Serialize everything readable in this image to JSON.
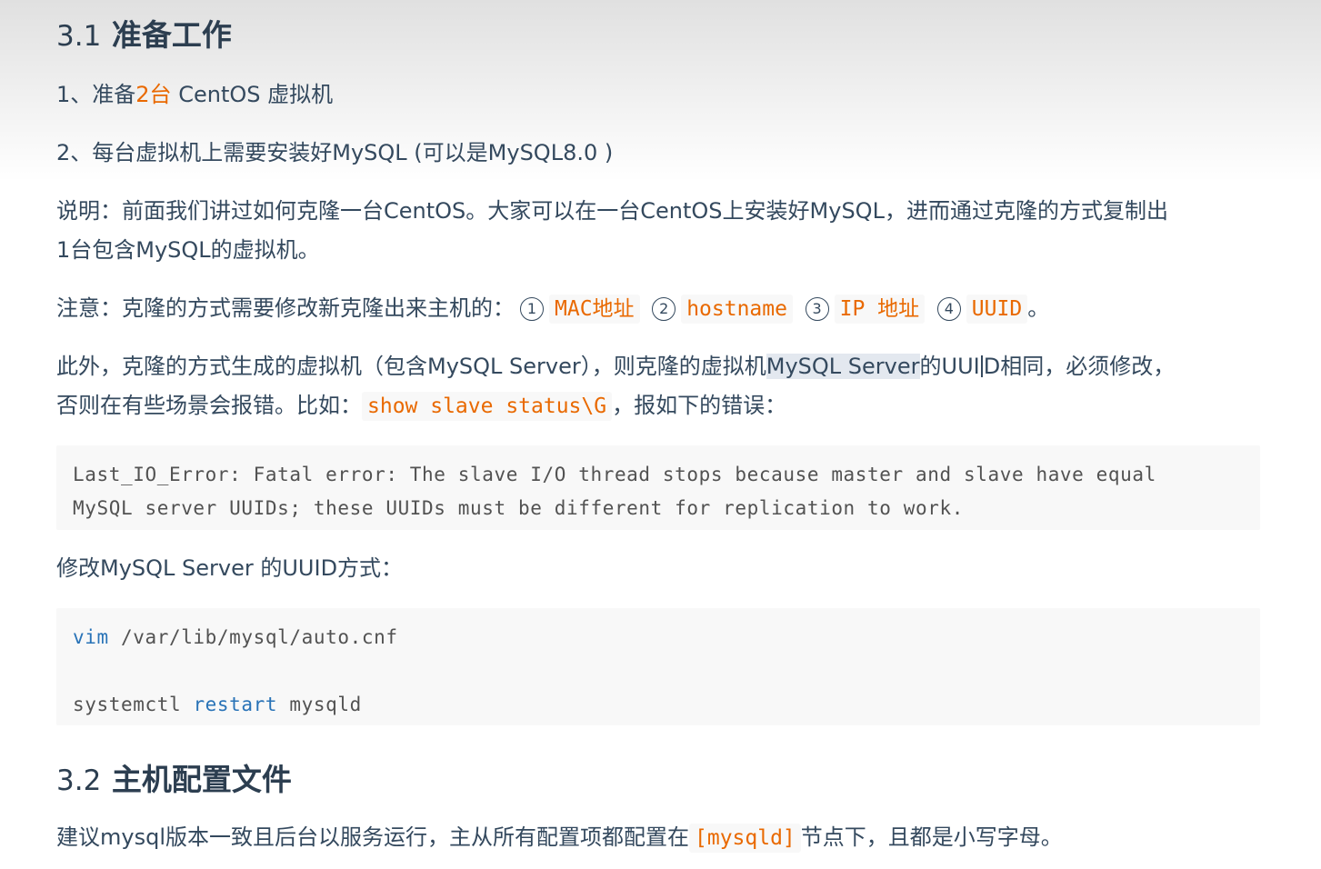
{
  "section_1": {
    "num": "3.1",
    "title": "准备工作"
  },
  "step_1": {
    "prefix": "1、准备",
    "count": "2台",
    "suffix": "CentOS 虚拟机"
  },
  "step_2": {
    "text": "2、每台虚拟机上需要安装好MySQL (可以是MySQL8.0 )"
  },
  "note_1": {
    "line_1": "说明：前面我们讲过如何克隆一台CentOS。大家可以在一台CentOS上安装好MySQL，进而通过克隆的方式复制出",
    "line_2": "1台包含MySQL的虚拟机。"
  },
  "note_2": {
    "prefix": "注意：克隆的方式需要修改新克隆出来主机的：",
    "items": [
      {
        "marker": "1",
        "code": "MAC地址"
      },
      {
        "marker": "2",
        "code": "hostname"
      },
      {
        "marker": "3",
        "code": "IP 地址"
      },
      {
        "marker": "4",
        "code": "UUID"
      }
    ],
    "suffix": "。"
  },
  "note_3": {
    "part_1": "此外，克隆的方式生成的虚拟机（包含MySQL Server），则克隆的虚拟机",
    "selected": "MySQL Server",
    "part_2a": "的UUI",
    "part_2b": "D相同，必须修改，",
    "line_2_prefix": "否则在有些场景会报错。比如：",
    "line_2_code": "show slave status\\G",
    "line_2_suffix": "，报如下的错误："
  },
  "error_block": {
    "line_1": "Last_IO_Error: Fatal error: The slave I/O thread stops because master and slave have equal",
    "line_2": "MySQL server UUIDs; these UUIDs must be different for replication to work."
  },
  "modify_heading": {
    "text": "修改MySQL Server 的UUID方式："
  },
  "cmd_block": {
    "line_1_kw": "vim",
    "line_1_rest": " /var/lib/mysql/auto.cnf",
    "line_3_cmd": "systemctl ",
    "line_3_kw": "restart",
    "line_3_rest": " mysqld"
  },
  "section_2": {
    "num": "3.2",
    "title": "主机配置文件"
  },
  "final_note": {
    "prefix": "建议mysql版本一致且后台以服务运行，主从所有配置项都配置在",
    "code": "[mysqld]",
    "suffix": "节点下，且都是小写字母。"
  }
}
